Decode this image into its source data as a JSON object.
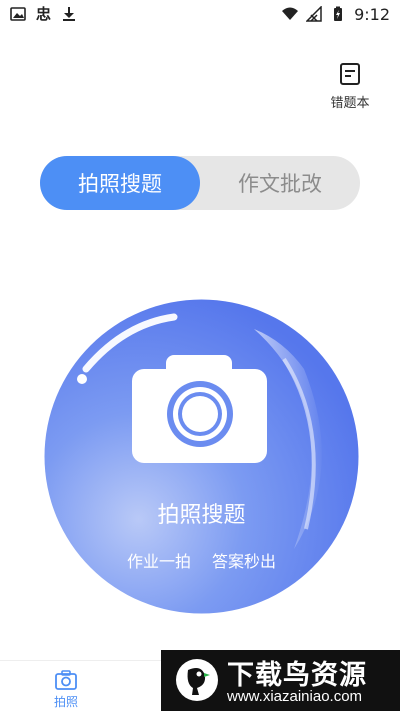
{
  "status_bar": {
    "time": "9:12",
    "left_icons": [
      "image-icon",
      "app-icon",
      "download-icon"
    ],
    "right_icons": [
      "wifi-icon",
      "signal-icon",
      "battery-icon"
    ],
    "app_glyph": "忠"
  },
  "header": {
    "notebook_label": "错题本"
  },
  "segmented": {
    "tabs": [
      {
        "label": "拍照搜题",
        "active": true
      },
      {
        "label": "作文批改",
        "active": false
      }
    ]
  },
  "camera": {
    "title": "拍照搜题",
    "subtitle_left": "作业一拍",
    "subtitle_right": "答案秒出"
  },
  "bottom_nav": {
    "items": [
      {
        "label": "拍照",
        "active": true
      }
    ]
  },
  "watermark": {
    "title": "下载鸟资源",
    "url": "www.xiazainiao.com"
  },
  "colors": {
    "accent": "#4d8ff5",
    "circle": "#5b82ef",
    "tab_inactive_bg": "#e6e6e6"
  }
}
